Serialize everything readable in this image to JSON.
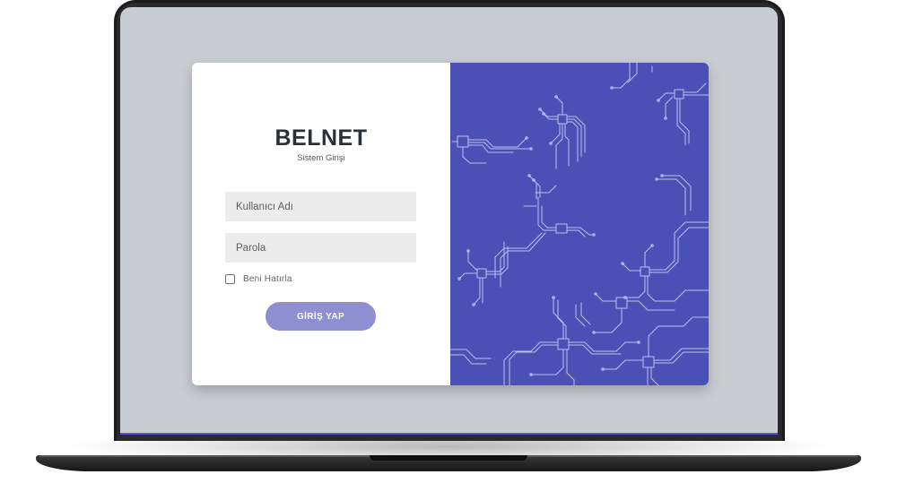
{
  "login": {
    "brand_title": "BELNET",
    "brand_subtitle": "Sistem Girişi",
    "username_placeholder": "Kullanıcı Adı",
    "password_placeholder": "Parola",
    "remember_label": "Beni Hatırla",
    "submit_label": "GİRİŞ YAP"
  },
  "colors": {
    "accent_panel": "#4a50b5",
    "button": "#8d8fd0",
    "screen_background": "#c9cdd2"
  }
}
